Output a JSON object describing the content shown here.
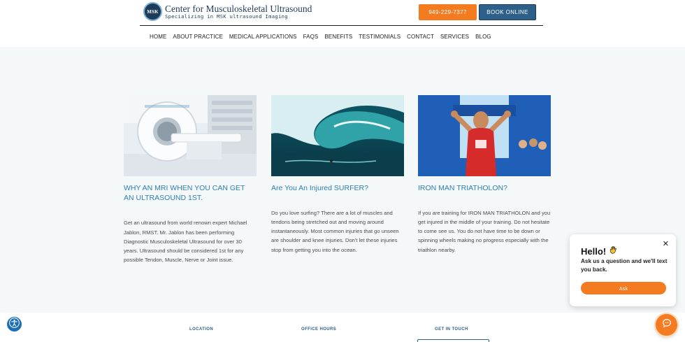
{
  "logo": {
    "mark": "MSK",
    "title": "Center for Musculoskeletal Ultrasound",
    "subtitle": "Specializing in MSK ultrasound Imaging"
  },
  "header": {
    "phone_label": "949-229-7377",
    "book_label": "BOOK ONLINE"
  },
  "nav": {
    "items": [
      "HOME",
      "ABOUT PRACTICE",
      "MEDICAL APPLICATIONS",
      "FAQS",
      "BENEFITS",
      "TESTIMONIALS",
      "CONTACT",
      "SERVICES",
      "BLOG"
    ]
  },
  "cards": [
    {
      "title": "WHY AN MRI WHEN YOU CAN GET AN ULTRASOUND 1ST.",
      "body": "Get an ultrasound from world renown expert Michael Jablon, RMST. Mr. Jablon has been performing Diagnostic Musculoskeletal Ultrasound for over 30 years. Ultrasound should be considered 1st for any possible Tendon, Muscle, Nerve or Joint issue."
    },
    {
      "title": "Are You An Injured SURFER?",
      "body": "Do you love surfing? There are a lot of muscles and tendons being stretched out and moving around instantaneously. Most common injuries that go unseen are shoulder and knee injuries. Don't let these injuries stop from getting you into the ocean."
    },
    {
      "title": "IRON MAN TRIATHOLON?",
      "body": "If you are training for IRON MAN TRIATHOLON and you get injured in the middle of your training. Do not hesitate to come see us. You do not have time to be down or spinning wheels making no progress especially with the triathlon nearby."
    }
  ],
  "footer": {
    "location": "LOCATION",
    "hours": "OFFICE HOURS",
    "contact": "GET IN TOUCH"
  },
  "chat": {
    "greeting": "Hello!",
    "message": "Ask us a question and we'll text you back.",
    "ask_label": "Ask"
  },
  "colors": {
    "accent_orange": "#f47b20",
    "brand_blue": "#2d5f88",
    "title_blue": "#2d7fb3",
    "page_bg": "#f5f8f9"
  },
  "icons": [
    "accessibility-icon",
    "chat-bubble-icon",
    "close-icon",
    "waving-hand-icon"
  ]
}
